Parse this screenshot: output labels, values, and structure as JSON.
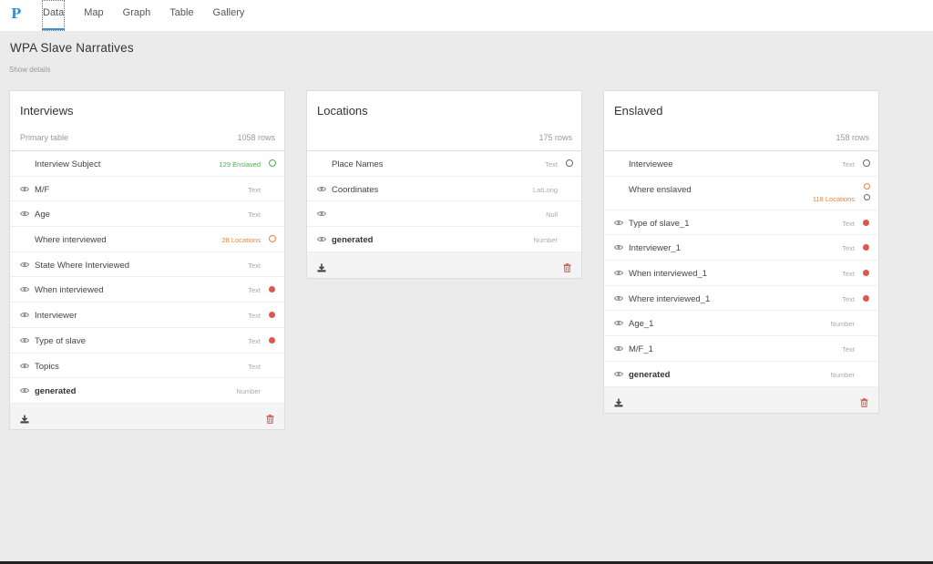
{
  "app": {
    "logo": "P"
  },
  "nav": [
    {
      "label": "Data",
      "active": true
    },
    {
      "label": "Map",
      "active": false
    },
    {
      "label": "Graph",
      "active": false
    },
    {
      "label": "Table",
      "active": false
    },
    {
      "label": "Gallery",
      "active": false
    }
  ],
  "page": {
    "title": "WPA Slave Narratives",
    "show_details": "Show details"
  },
  "cards": [
    {
      "title": "Interviews",
      "subtitle": "Primary table",
      "rows_label": "1058 rows",
      "fields": [
        {
          "name": "Interview Subject",
          "eye": false,
          "link": "129 Enslaved",
          "link_color": "green",
          "marker": "circle-green"
        },
        {
          "name": "M/F",
          "eye": true,
          "type": "Text"
        },
        {
          "name": "Age",
          "eye": true,
          "type": "Text"
        },
        {
          "name": "Where interviewed",
          "eye": false,
          "link": "28 Locations",
          "link_color": "orange",
          "marker": "circle-orange"
        },
        {
          "name": "State Where Interviewed",
          "eye": true,
          "type": "Text"
        },
        {
          "name": "When interviewed",
          "eye": true,
          "type": "Text",
          "marker": "dot"
        },
        {
          "name": "Interviewer",
          "eye": true,
          "type": "Text",
          "marker": "dot"
        },
        {
          "name": "Type of slave",
          "eye": true,
          "type": "Text",
          "marker": "dot"
        },
        {
          "name": "Topics",
          "eye": true,
          "type": "Text"
        },
        {
          "name": "generated",
          "eye": true,
          "type": "Number",
          "bold": true
        }
      ]
    },
    {
      "title": "Locations",
      "subtitle": "",
      "rows_label": "175 rows",
      "fields": [
        {
          "name": "Place Names",
          "eye": false,
          "type": "Text",
          "marker": "circle-grey"
        },
        {
          "name": "Coordinates",
          "eye": true,
          "type": "LatLong"
        },
        {
          "name": "",
          "eye": true,
          "type": "Null"
        },
        {
          "name": "generated",
          "eye": true,
          "type": "Number",
          "bold": true
        }
      ]
    },
    {
      "title": "Enslaved",
      "subtitle": "",
      "rows_label": "158 rows",
      "fields": [
        {
          "name": "Interviewee",
          "eye": false,
          "type": "Text",
          "marker": "circle-grey"
        },
        {
          "name": "Where enslaved",
          "eye": false,
          "link": "118 Locations",
          "link_color": "orange",
          "marker": "circle-double",
          "tall": true
        },
        {
          "name": "Type of slave_1",
          "eye": true,
          "type": "Text",
          "marker": "dot"
        },
        {
          "name": "Interviewer_1",
          "eye": true,
          "type": "Text",
          "marker": "dot"
        },
        {
          "name": "When interviewed_1",
          "eye": true,
          "type": "Text",
          "marker": "dot"
        },
        {
          "name": "Where interviewed_1",
          "eye": true,
          "type": "Text",
          "marker": "dot"
        },
        {
          "name": "Age_1",
          "eye": true,
          "type": "Number"
        },
        {
          "name": "M/F_1",
          "eye": true,
          "type": "Text"
        },
        {
          "name": "generated",
          "eye": true,
          "type": "Number",
          "bold": true
        }
      ]
    }
  ],
  "colors": {
    "accent": "#3b8fd6",
    "dot": "#e0574a",
    "green": "#4caf50",
    "orange": "#e8833a"
  },
  "icons": {
    "eye": "eye-icon",
    "download": "download-icon",
    "trash": "trash-icon"
  }
}
